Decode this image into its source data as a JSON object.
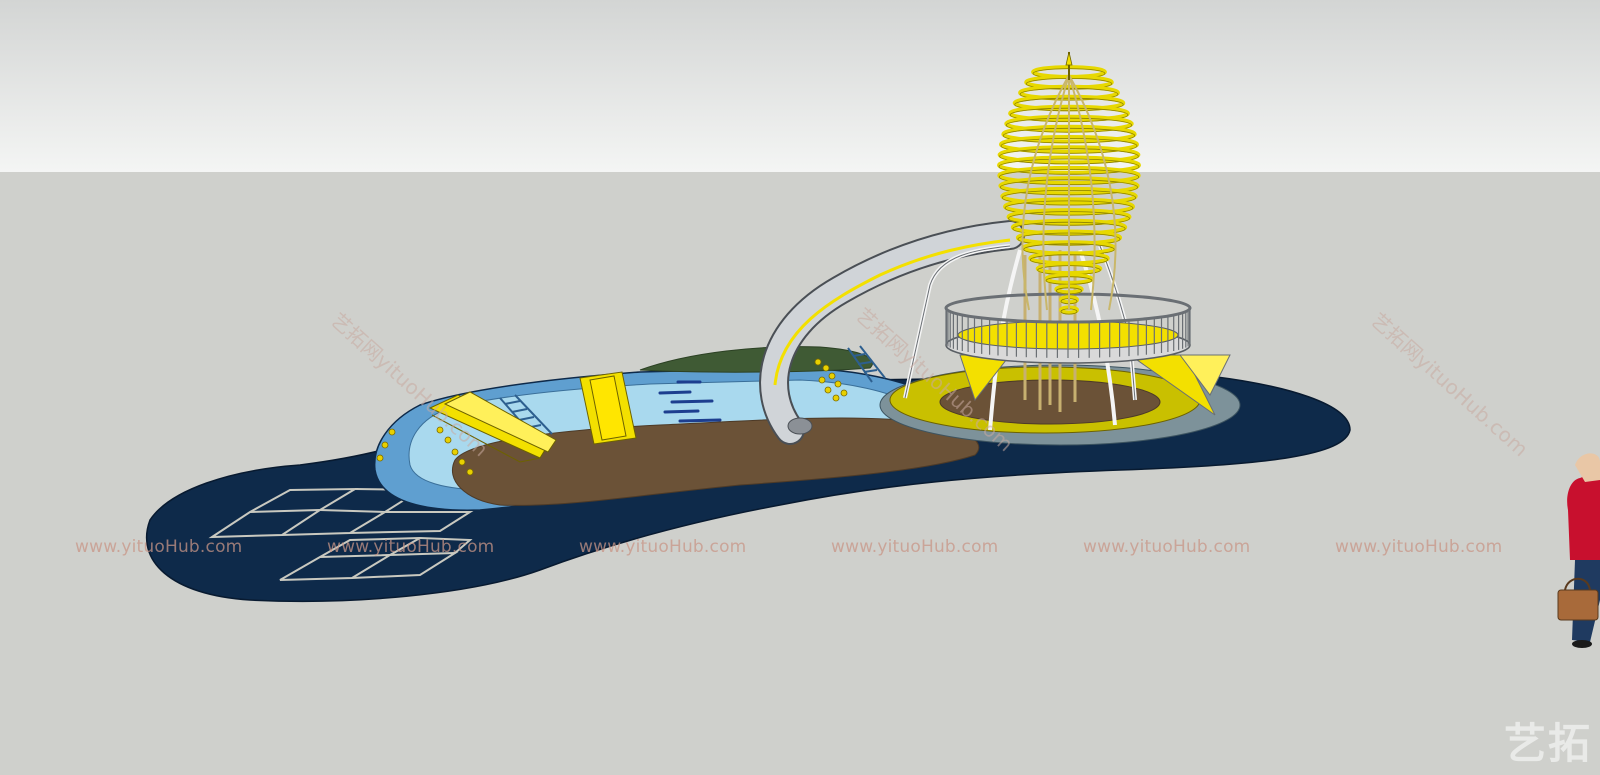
{
  "watermark": {
    "row": [
      "www.yituoHub.com",
      "www.yituoHub.com",
      "www.yituoHub.com",
      "www.yituoHub.com",
      "www.yituoHub.com",
      "www.yituoHub.com"
    ],
    "diagonal": [
      "艺拓网yituoHub.com",
      "艺拓网yituoHub.com",
      "艺拓网yituoHub.com"
    ],
    "corner_logo": "艺拓"
  },
  "colors": {
    "sky_top": "#d4d6d5",
    "sky_bottom": "#f3f4f3",
    "ground": "#cfd0cc",
    "base_navy": "#0e2a4a",
    "pool_light_blue": "#a9d9ee",
    "pool_wall_blue": "#5f9fd0",
    "sand_brown": "#6b5237",
    "accent_yellow": "#f3e000",
    "slide_gray": "#c8ccd0",
    "grass_green": "#3f5a34"
  },
  "icons": [
    "rocket-tower-icon",
    "person-figure-icon"
  ]
}
